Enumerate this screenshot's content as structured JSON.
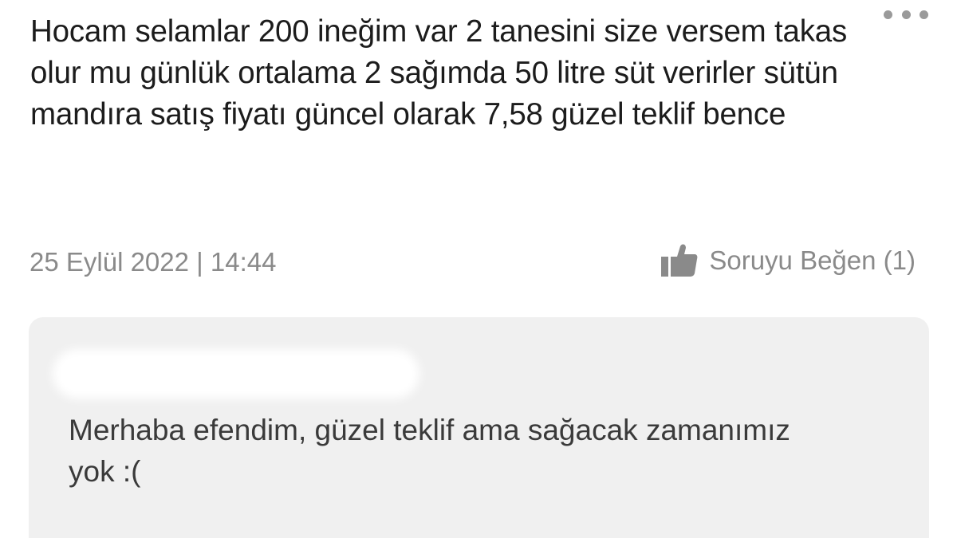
{
  "question": {
    "text": "Hocam selamlar 200 ineğim var 2 tanesini size versem takas olur mu günlük ortalama 2 sağımda 50 litre süt verirler sütün mandıra satış fiyatı güncel olarak 7,58 güzel teklif bence",
    "date": "25 Eylül 2022 | 14:44",
    "like_label": "Soruyu Beğen (1)",
    "like_icon": "thumbs-up-icon",
    "more_icon": "more-dots-icon"
  },
  "answer": {
    "text": "Merhaba efendim, güzel teklif ama sağacak zamanımız yok :("
  },
  "colors": {
    "text_primary": "#1c1c1c",
    "text_muted": "#8a8a8a",
    "card_background": "#f0f0f0"
  }
}
